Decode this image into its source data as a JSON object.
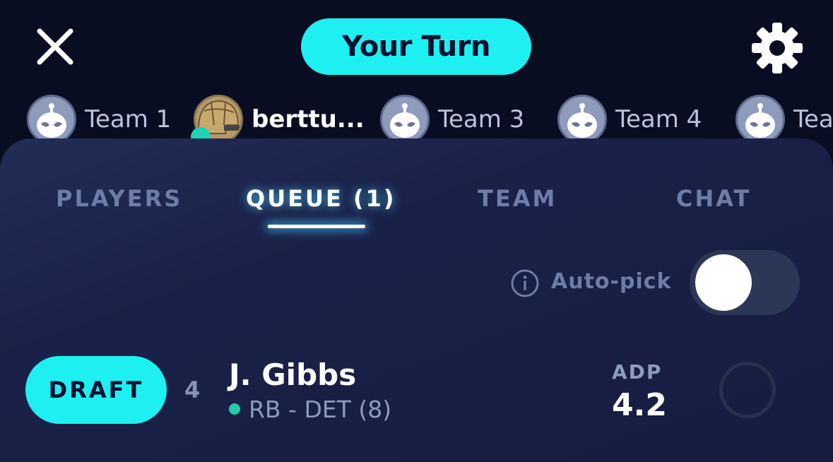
{
  "header": {
    "close_icon": "close-icon",
    "turn_label": "Your Turn",
    "settings_icon": "gear-icon",
    "colors": {
      "accent": "#1ef0f2",
      "background": "#090d22"
    }
  },
  "teams": [
    {
      "name": "Team 1",
      "avatar": "robot-avatar"
    },
    {
      "name": "berttu...",
      "avatar": "helmet-avatar",
      "current": true
    },
    {
      "name": "Team 3",
      "avatar": "robot-avatar"
    },
    {
      "name": "Team 4",
      "avatar": "robot-avatar"
    },
    {
      "name": "Tea",
      "avatar": "robot-avatar"
    }
  ],
  "tabs": [
    {
      "label": "PLAYERS"
    },
    {
      "label": "QUEUE (1)",
      "active": true
    },
    {
      "label": "TEAM"
    },
    {
      "label": "CHAT"
    }
  ],
  "autopick": {
    "label": "Auto-pick",
    "info_icon": "info-icon",
    "enabled": false
  },
  "queue": [
    {
      "draft_label": "DRAFT",
      "rank": "4",
      "name": "J. Gibbs",
      "meta": "RB - DET (8)",
      "adp_label": "ADP",
      "adp": "4.2"
    }
  ]
}
